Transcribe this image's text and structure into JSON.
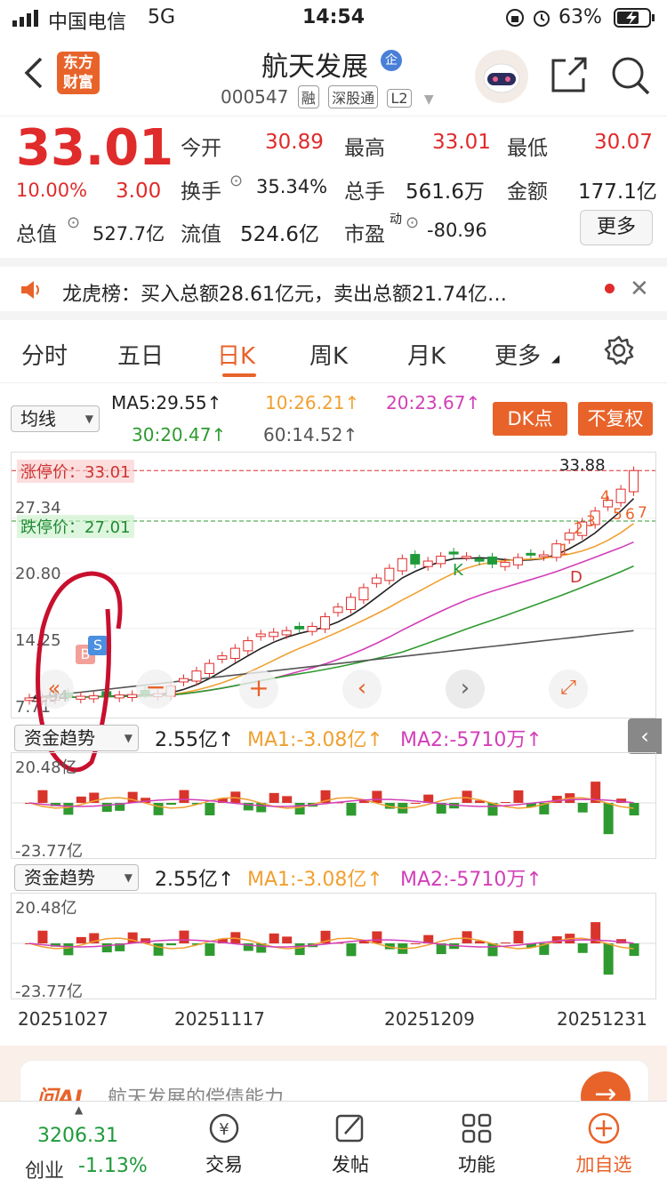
{
  "status_bar": {
    "carrier": "中国电信",
    "network": "5G",
    "time": "14:54",
    "battery": "63%"
  },
  "header": {
    "logo_line1": "东方",
    "logo_line2": "财富",
    "stock_name": "航天发展",
    "badge": "企",
    "code": "000547",
    "tags": [
      "融",
      "深股通",
      "L2"
    ]
  },
  "quote": {
    "price": "33.01",
    "change_pct": "10.00%",
    "change": "3.00",
    "rows": [
      [
        {
          "label": "今开",
          "value": "30.89"
        },
        {
          "label": "最高",
          "value": "33.01"
        },
        {
          "label": "最低",
          "value": "30.07"
        }
      ],
      [
        {
          "label": "换手",
          "value": "35.34%"
        },
        {
          "label": "总手",
          "value": "561.6万"
        },
        {
          "label": "金额",
          "value": "177.1亿"
        }
      ],
      [
        {
          "label": "总值",
          "value": "527.7亿"
        },
        {
          "label": "流值",
          "value": "524.6亿"
        },
        {
          "label": "市盈",
          "sup": "动",
          "value": "-80.96"
        }
      ]
    ],
    "more_button": "更多"
  },
  "notice": {
    "text": "龙虎榜：买入总额28.61亿元，卖出总额21.74亿…"
  },
  "tabs": {
    "items": [
      "分时",
      "五日",
      "日K",
      "周K",
      "月K",
      "更多"
    ],
    "active": "日K"
  },
  "ma_bar": {
    "dropdown": "均线",
    "ma5": "MA5:29.55↑",
    "ma10": "10:26.21↑",
    "ma20": "20:23.67↑",
    "ma30": "30:20.47↑",
    "ma60": "60:14.52↑",
    "dk_button": "DK点",
    "fq_button": "不复权",
    "colors": {
      "ma5": "#222222",
      "ma10": "#f0a030",
      "ma20": "#d23fb8",
      "ma30": "#2f9a2f",
      "ma60": "#555555"
    }
  },
  "kchart": {
    "y_labels": [
      "33.88",
      "27.34",
      "20.80",
      "14.25",
      "7.71"
    ],
    "limit_up": "涨停价：33.01",
    "limit_down": "跌停价：27.01",
    "high_label": "33.88",
    "low_label": "4.94",
    "markers": {
      "B": "B",
      "S": "S",
      "K": "K",
      "D": "D",
      "nums": [
        "1",
        "2",
        "3",
        "4",
        "5",
        "6",
        "7"
      ]
    }
  },
  "flow1": {
    "dropdown": "资金趋势",
    "value": "2.55亿↑",
    "ma1": "MA1:-3.08亿↑",
    "ma2": "MA2:-5710万↑",
    "top": "20.48亿",
    "bottom": "-23.77亿"
  },
  "flow2": {
    "dropdown": "资金趋势",
    "value": "2.55亿↑",
    "ma1": "MA1:-3.08亿↑",
    "ma2": "MA2:-5710万↑",
    "top": "20.48亿",
    "bottom": "-23.77亿"
  },
  "dates": [
    "20251027",
    "20251117",
    "20251209",
    "20251231"
  ],
  "ai_bar": {
    "logo": "问AI",
    "text": "航天发展的偿债能力"
  },
  "bottom_nav": {
    "index_value": "3206.31",
    "index_name": "创业",
    "index_change": "-1.13%",
    "items": [
      "交易",
      "发帖",
      "功能",
      "加自选"
    ]
  }
}
